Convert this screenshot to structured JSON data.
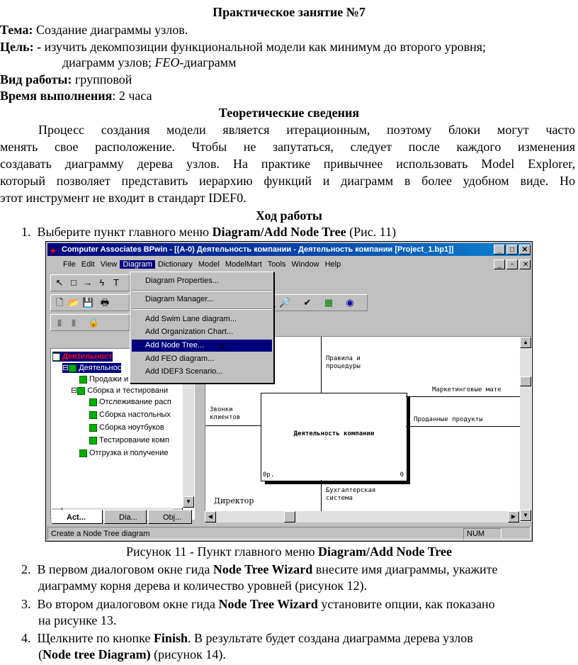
{
  "header": {
    "title": "Практическое занятие №7"
  },
  "meta": {
    "topic_label": "Тема:",
    "topic": "Создание диаграммы узлов.",
    "goal_label": "Цель: -",
    "goal_line1": "изучить декомпозиции функциональной модели как минимум до второго уровня;",
    "goal_line2_pre": "диаграмм узлов; ",
    "goal_line2_em": "FEO",
    "goal_line2_post": "-диаграмм",
    "work_label": "Вид работы:",
    "work": "групповой",
    "time_label": "Время выполнения",
    "time": ": 2 часа"
  },
  "theory": {
    "heading": "Теоретические сведения",
    "lines": [
      "Процесс создания модели является итерационным, поэтому блоки могут часто",
      "менять свое расположение. Чтобы не запутаться, следует после каждого изменения",
      "создавать диаграмму дерева узлов. На практике привычнее использовать Model Explorer,",
      "который позволяет представить иерархию функций и диаграмм в более удобном виде. Но",
      "этот инструмент не входит в стандарт IDEF0."
    ]
  },
  "procedure": {
    "heading": "Ход работы",
    "step1_num": "1.",
    "step1_pre": "Выберите пункт главного меню ",
    "step1_bold": "Diagram/Add Node Tree",
    "step1_post": " (Рис. 11)",
    "caption_pre": "Рисунок 11 - Пункт главного меню ",
    "caption_bold": "Diagram/Add Node Tree",
    "step2_num": "2.",
    "step2_pre": "В первом диалоговом окне гида ",
    "step2_bold": "Node Tree Wizard",
    "step2_post": " внесите имя диаграммы, укажите",
    "step2_line2": "диаграмму корня дерева и количество уровней (рисунок 12).",
    "step3_num": "3.",
    "step3_pre": "Во втором диалоговом окне гида ",
    "step3_bold": "Node Tree Wizard",
    "step3_post": " установите опции, как показано",
    "step3_line2": "на рисунке 13.",
    "step4_num": "4.",
    "step4_pre": "Щелкните по кнопке ",
    "step4_bold": "Finish",
    "step4_post": ". В результате будет создана диаграмма дерева узлов",
    "step4_line2_pre": "(",
    "step4_line2_bold": "Node tree Diagram)",
    "step4_line2_post": " (рисунок 14)."
  },
  "app": {
    "title": "Computer Associates BPwin - [(A-0) Деятельность компании - Деятельность компании  [Project_1.bp1]]",
    "menu": [
      "File",
      "Edit",
      "View",
      "Diagram",
      "Dictionary",
      "Model",
      "ModelMart",
      "Tools",
      "Window",
      "Help"
    ],
    "dropdown": [
      "Diagram Properties...",
      "Diagram Manager...",
      "Add Swim Lane diagram...",
      "Add Organization Chart...",
      "Add Node Tree...",
      "Add FEO diagram...",
      "Add IDEF3 Scenario..."
    ],
    "tree": [
      "Деятельност",
      "Деятельнос",
      "Продажи и маркети",
      "Сборка и тестировани",
      "Отслеживание расп",
      "Сборка настольных",
      "Сборка ноутбуков",
      "Тестирование комп",
      "Отгрузка и получение"
    ],
    "tabs": [
      "Act...",
      "Dia...",
      "Obj..."
    ],
    "canvas": {
      "box_label": "Деятельность компании",
      "box_corner_left": "0р.",
      "box_corner_right": "0",
      "control": "Правила и\nпроцедуры",
      "input": "Звонки\nклиентов",
      "output1": "Маркетинговые мате",
      "output2": "Проданные продукты",
      "mechanism": "Бухгалтерская\nсистема",
      "mechanism2": "Директор"
    },
    "status": "Create a Node Tree diagram",
    "status_num": "NUM"
  }
}
